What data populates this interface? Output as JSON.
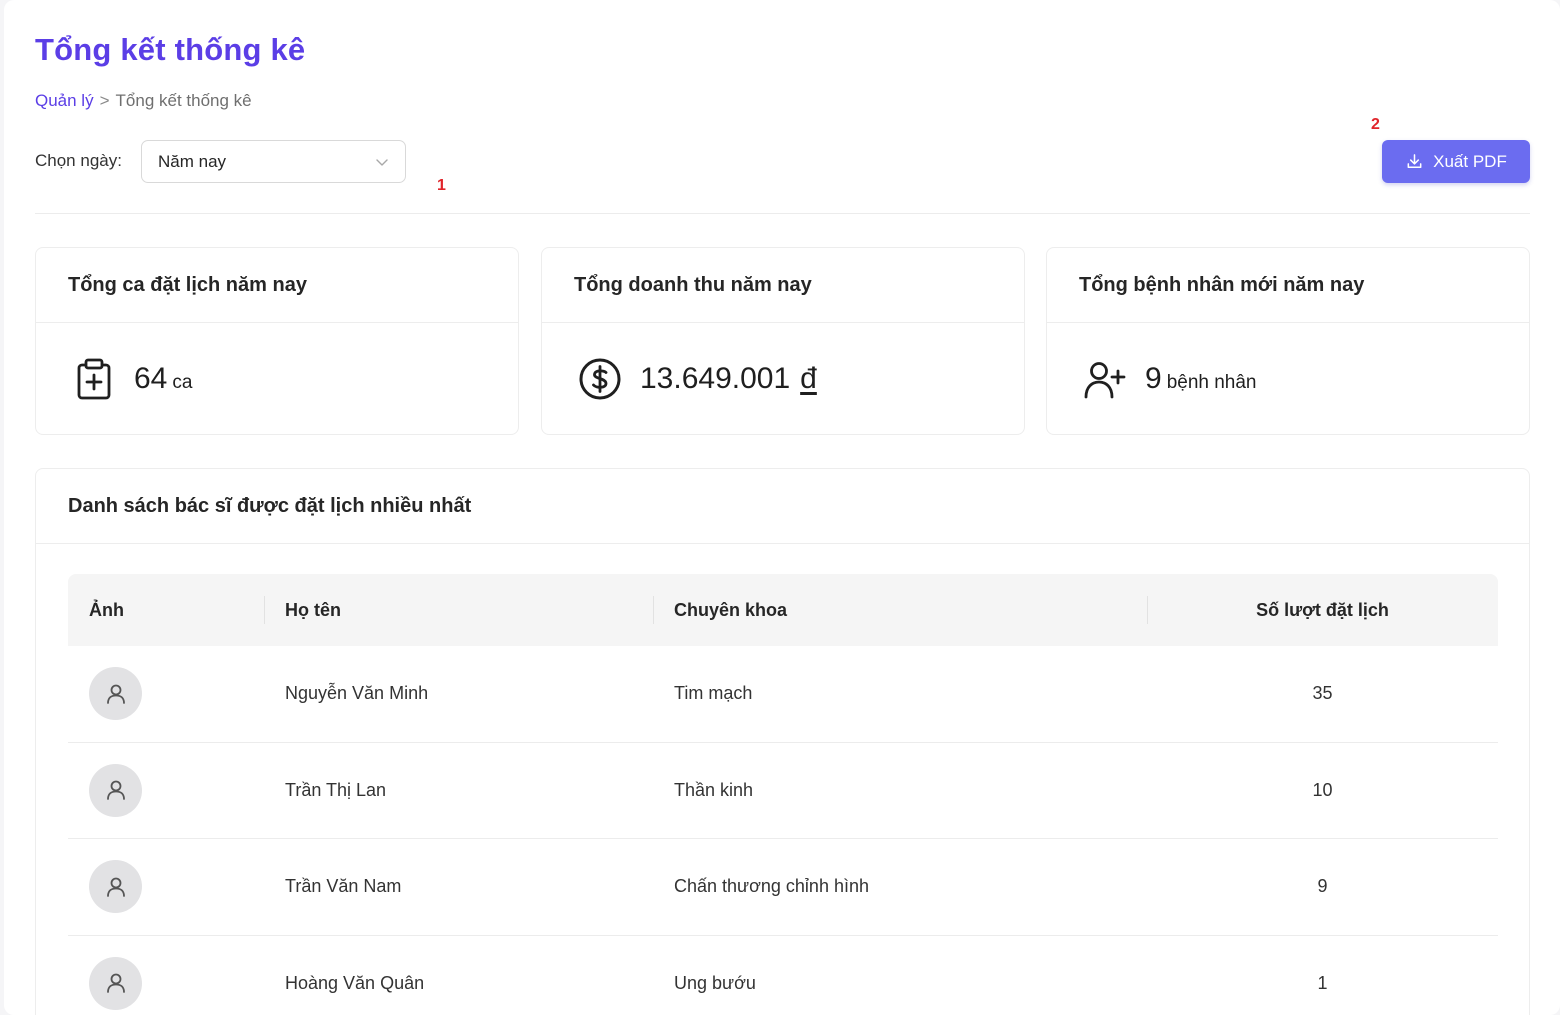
{
  "page": {
    "title": "Tổng kết thống kê",
    "breadcrumb": {
      "parent": "Quản lý",
      "separator": ">",
      "current": "Tổng kết thống kê"
    }
  },
  "filter": {
    "label": "Chọn ngày:",
    "selected": "Năm nay",
    "marker": "1"
  },
  "export": {
    "label": "Xuất PDF",
    "icon": "download-icon",
    "marker": "2"
  },
  "stats": [
    {
      "title": "Tổng ca đặt lịch năm nay",
      "icon": "clipboard-plus-icon",
      "value": "64",
      "unit": "ca"
    },
    {
      "title": "Tổng doanh thu năm nay",
      "icon": "dollar-circle-icon",
      "value": "13.649.001",
      "unit": "đ"
    },
    {
      "title": "Tổng bệnh nhân mới năm nay",
      "icon": "user-plus-icon",
      "value": "9",
      "unit": "bệnh nhân"
    }
  ],
  "doctors": {
    "title": "Danh sách bác sĩ được đặt lịch nhiều nhất",
    "columns": [
      "Ảnh",
      "Họ tên",
      "Chuyên khoa",
      "Số lượt đặt lịch"
    ],
    "rows": [
      {
        "name": "Nguyễn Văn Minh",
        "specialty": "Tim mạch",
        "bookings": "35"
      },
      {
        "name": "Trần Thị Lan",
        "specialty": "Thần kinh",
        "bookings": "10"
      },
      {
        "name": "Trần Văn Nam",
        "specialty": "Chấn thương chỉnh hình",
        "bookings": "9"
      },
      {
        "name": "Hoàng Văn Quân",
        "specialty": "Ung bướu",
        "bookings": "1"
      }
    ]
  },
  "colors": {
    "accent": "#5b3ee6",
    "button": "#6b6cf0",
    "marker": "#e0242a",
    "avatar_bg": "#e2e2e4"
  }
}
